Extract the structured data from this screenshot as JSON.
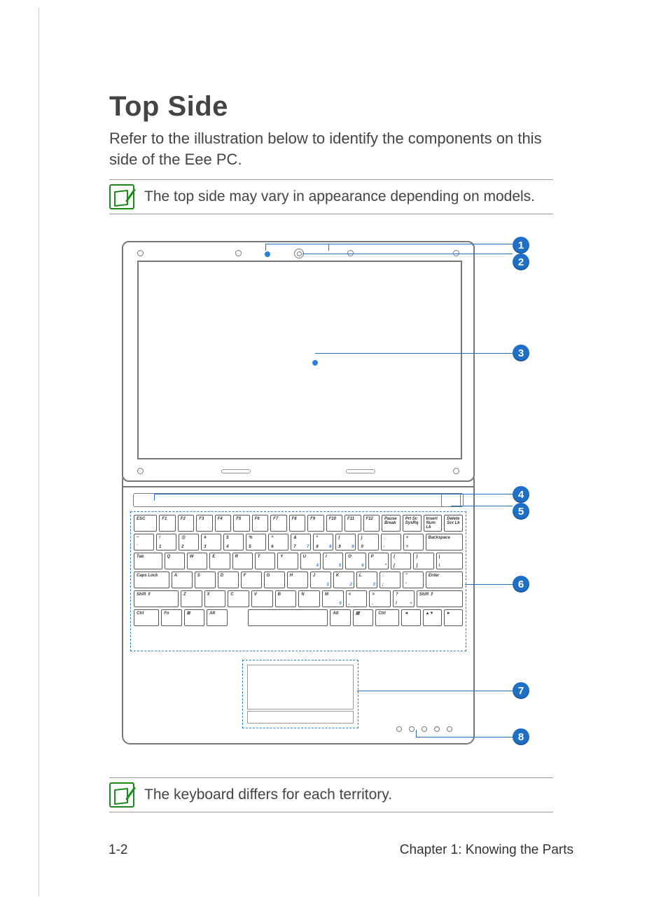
{
  "heading": "Top Side",
  "intro": "Refer to the illustration below to identify the components on this side of the Eee PC.",
  "note1": "The top side may vary in appearance depending on models.",
  "note2": "The keyboard differs for each territory.",
  "footer": {
    "page": "1-2",
    "chapter": "Chapter 1: Knowing the Parts"
  },
  "callouts": [
    "1",
    "2",
    "3",
    "4",
    "5",
    "6",
    "7",
    "8"
  ],
  "keyboard": {
    "row1": [
      "ESC",
      "F1",
      "F2",
      "F3",
      "F4",
      "F5",
      "F6",
      "F7",
      "F8",
      "F9",
      "F10",
      "F11",
      "F12",
      "Pause Break",
      "Prt Sc SysRq",
      "Insert Num Lk",
      "Delete Scr Lk"
    ],
    "row2": [
      {
        "t": "~",
        "b": "`"
      },
      {
        "t": "!",
        "b": "1"
      },
      {
        "t": "@",
        "b": "2"
      },
      {
        "t": "#",
        "b": "3"
      },
      {
        "t": "$",
        "b": "4"
      },
      {
        "t": "%",
        "b": "5"
      },
      {
        "t": "^",
        "b": "6"
      },
      {
        "t": "&",
        "b": "7",
        "s": "7"
      },
      {
        "t": "*",
        "b": "8",
        "s": "8"
      },
      {
        "t": "(",
        "b": "9",
        "s": "9"
      },
      {
        "t": ")",
        "b": "0"
      },
      {
        "t": "_",
        "b": "-"
      },
      {
        "t": "+",
        "b": "="
      },
      {
        "t": "Backspace"
      }
    ],
    "row3": [
      "Tab",
      "Q",
      "W",
      "E",
      "R",
      "T",
      "Y",
      {
        "t": "U",
        "s": "4"
      },
      {
        "t": "I",
        "s": "5"
      },
      {
        "t": "O",
        "s": "6"
      },
      {
        "t": "P",
        "s": "*"
      },
      {
        "t": "{",
        "b": "["
      },
      {
        "t": "}",
        "b": "]"
      },
      {
        "t": "|",
        "b": "\\"
      }
    ],
    "row4": [
      "Caps Lock",
      "A",
      "S",
      "D",
      "F",
      "G",
      "H",
      {
        "t": "J",
        "s": "1"
      },
      {
        "t": "K",
        "s": "2"
      },
      {
        "t": "L",
        "s": "3"
      },
      {
        "t": ":",
        "b": ";"
      },
      {
        "t": "\"",
        "b": "'"
      },
      "Enter"
    ],
    "row5": [
      "Shift ⇧",
      "Z",
      "X",
      "C",
      "V",
      "B",
      "N",
      {
        "t": "M",
        "s": "0"
      },
      {
        "t": "<",
        "b": ","
      },
      {
        "t": ">",
        "b": "."
      },
      {
        "t": "?",
        "b": "/",
        "s": "+"
      },
      "Shift ⇧"
    ],
    "row6": [
      "Ctrl",
      "Fn",
      "⊞",
      "Alt",
      "",
      "",
      "Alt",
      "▤",
      "Ctrl",
      "◄",
      "▲▼",
      "►"
    ]
  }
}
